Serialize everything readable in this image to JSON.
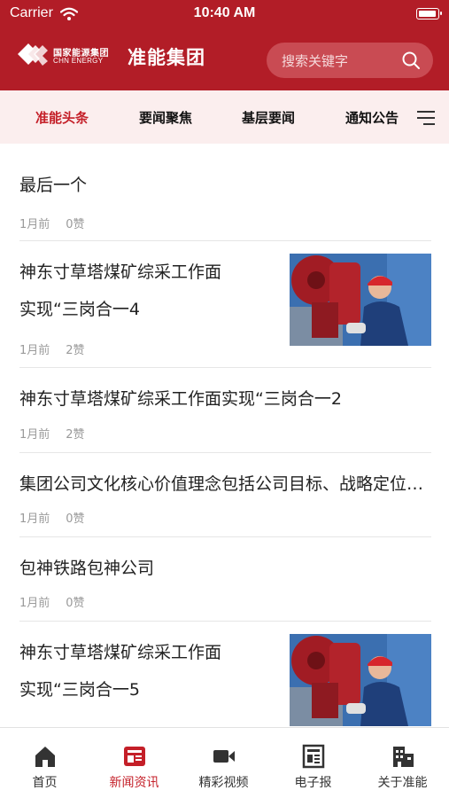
{
  "status_bar": {
    "carrier": "Carrier",
    "time": "10:40 AM"
  },
  "header": {
    "brand_cn": "国家能源集团",
    "brand_en": "CHN ENERGY",
    "title": "准能集团",
    "search_placeholder": "搜索关键字",
    "color": "#b21d27"
  },
  "tabs": [
    {
      "label": "准能头条",
      "active": true
    },
    {
      "label": "要闻聚焦",
      "active": false
    },
    {
      "label": "基层要闻",
      "active": false
    },
    {
      "label": "通知公告",
      "active": false
    }
  ],
  "news": [
    {
      "title": "最后一个",
      "time": "1月前",
      "likes": "0赞"
    },
    {
      "title_line1": "神东寸草塔煤矿综采工作面",
      "title_line2": "实现“三岗合一4",
      "time": "1月前",
      "likes": "2赞",
      "image": "worker-photo"
    },
    {
      "title": "神东寸草塔煤矿综采工作面实现“三岗合一2",
      "time": "1月前",
      "likes": "2赞"
    },
    {
      "title": "集团公司文化核心价值理念包括公司目标、战略定位和核心价值观",
      "time": "1月前",
      "likes": "0赞"
    },
    {
      "title": "包神铁路包神公司",
      "time": "1月前",
      "likes": "0赞"
    },
    {
      "title_line1": "神东寸草塔煤矿综采工作面",
      "title_line2": "实现“三岗合一5",
      "image": "worker-photo"
    }
  ],
  "tabbar": [
    {
      "label": "首页",
      "icon": "home-icon",
      "active": false
    },
    {
      "label": "新闻资讯",
      "icon": "news-icon",
      "active": true
    },
    {
      "label": "精彩视频",
      "icon": "video-icon",
      "active": false
    },
    {
      "label": "电子报",
      "icon": "newspaper-icon",
      "active": false
    },
    {
      "label": "关于准能",
      "icon": "building-icon",
      "active": false
    }
  ],
  "accent_color": "#c41f28"
}
